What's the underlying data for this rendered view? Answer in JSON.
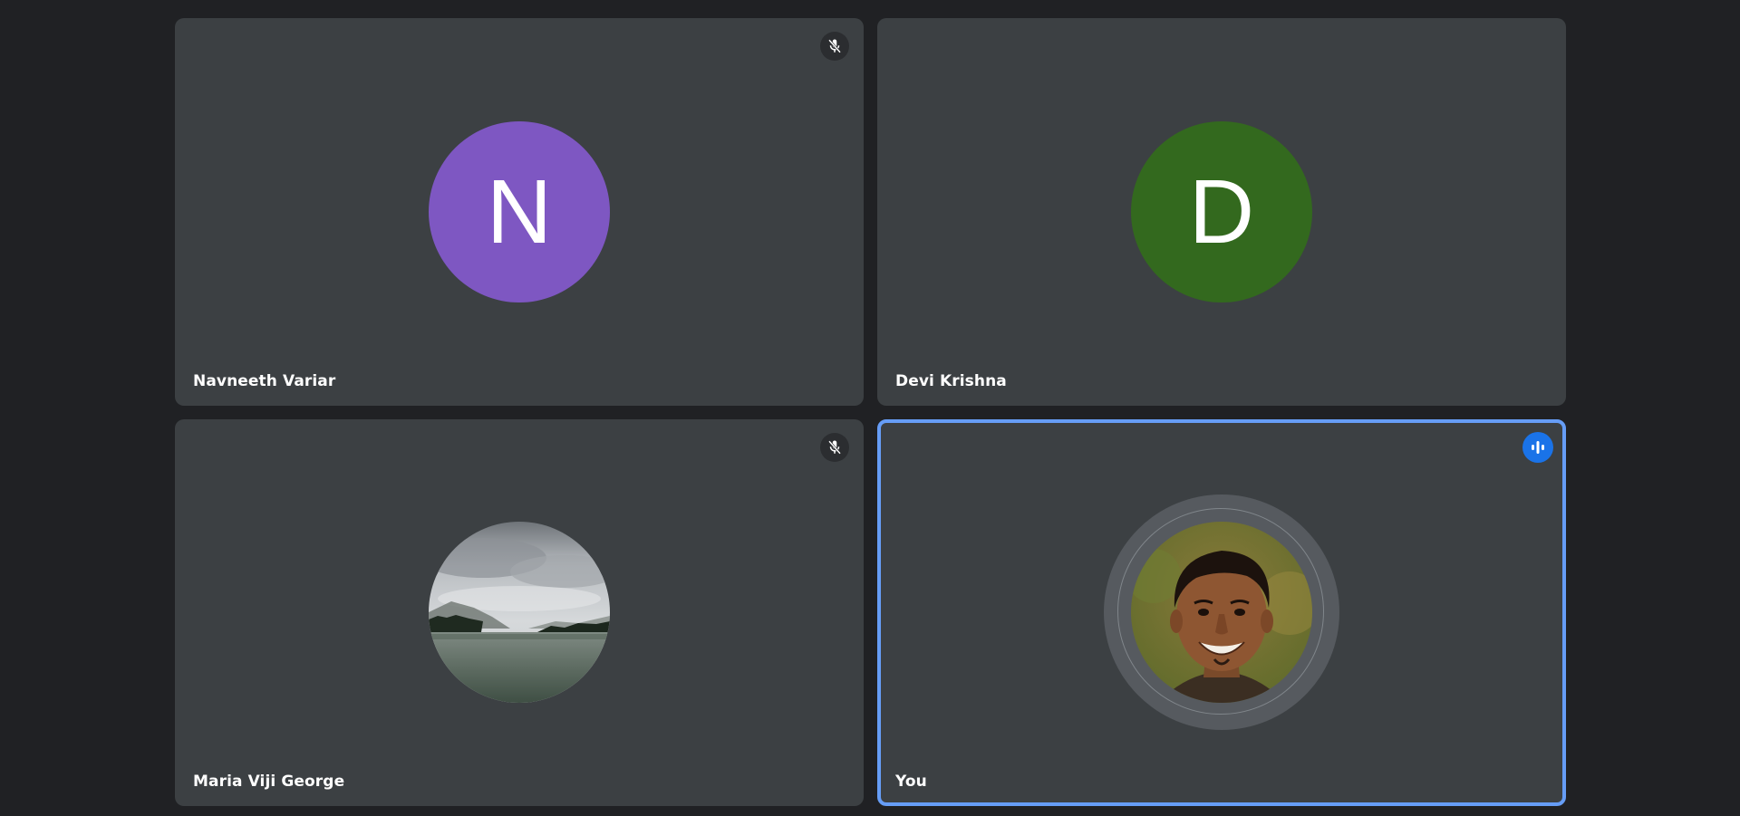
{
  "participants": [
    {
      "name": "Navneeth Variar",
      "initial": "N",
      "avatar_color": "#7e57c2",
      "muted": true,
      "icon": "mic-off-icon"
    },
    {
      "name": "Devi Krishna",
      "initial": "D",
      "avatar_color": "#33691e",
      "muted": false,
      "icon": null
    },
    {
      "name": "Maria Viji George",
      "avatar_image": "landscape-photo-lake-mountains",
      "muted": true,
      "icon": "mic-off-icon"
    },
    {
      "name": "You",
      "avatar_image": "profile-photo-smiling-man",
      "speaking": true,
      "icon": "audio-level-icon",
      "highlight_color": "#669df6"
    }
  ],
  "theme": {
    "background": "#202124",
    "tile": "#3c4043",
    "speaking_accent": "#1a73e8"
  }
}
